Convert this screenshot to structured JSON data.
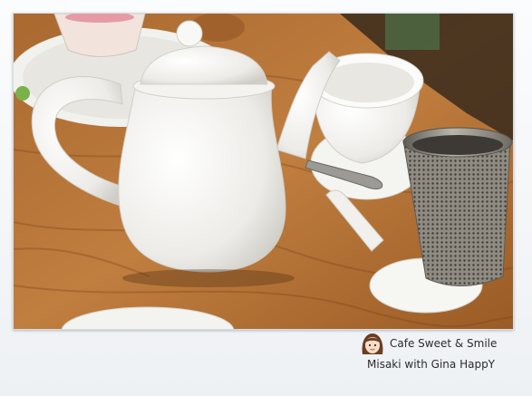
{
  "photo": {
    "subject": "white-teapot-cup-strainer-on-wooden-table",
    "colors": {
      "wood_light": "#b8773a",
      "wood_dark": "#7a4619",
      "porcelain": "#f7f7f5",
      "porcelain_shadow": "#d9d8d2",
      "steel": "#8d8a83"
    }
  },
  "caption": {
    "line1": "Cafe Sweet & Smile",
    "line2": "Misaki with Gina HappY",
    "avatar_icon": "girl-face-icon"
  }
}
